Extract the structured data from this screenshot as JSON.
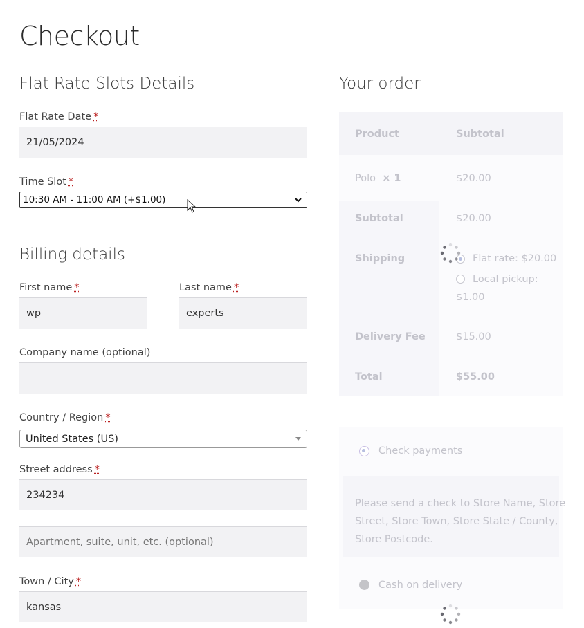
{
  "page": {
    "title": "Checkout"
  },
  "slots": {
    "title": "Flat Rate Slots Details",
    "date_label": "Flat Rate Date",
    "date_value": "21/05/2024",
    "slot_label": "Time Slot",
    "slot_value": "10:30 AM - 11:00 AM (+$1.00)",
    "required_mark": "*"
  },
  "billing": {
    "title": "Billing details",
    "first_name_label": "First name",
    "first_name_value": "wp",
    "last_name_label": "Last name",
    "last_name_value": "experts",
    "company_label": "Company name (optional)",
    "company_value": "",
    "country_label": "Country / Region",
    "country_value": "United States (US)",
    "street_label": "Street address",
    "street_value": "234234",
    "apartment_placeholder": "Apartment, suite, unit, etc. (optional)",
    "city_label": "Town / City",
    "city_value": "kansas"
  },
  "order": {
    "title": "Your order",
    "col_product": "Product",
    "col_subtotal": "Subtotal",
    "item_name": "Polo",
    "item_qty": "× 1",
    "item_price": "$20.00",
    "subtotal_label": "Subtotal",
    "subtotal_value": "$20.00",
    "shipping_label": "Shipping",
    "shipping_option_1": "Flat rate: $20.00",
    "shipping_option_2_line1": "Local pickup:",
    "shipping_option_2_line2": "$1.00",
    "fee_label": "Delivery Fee",
    "fee_value": "$15.00",
    "total_label": "Total",
    "total_value": "$55.00"
  },
  "payment": {
    "check_label": "Check payments",
    "check_desc_1": "Please send a check to Store Name, Store",
    "check_desc_2": "Street, Store Town, Store State / County,",
    "check_desc_3": "Store Postcode.",
    "cod_label": "Cash on delivery"
  },
  "colors": {
    "required": "#b22222",
    "field_bg": "#f2f2f4",
    "faded_text": "#c3c3cb"
  }
}
